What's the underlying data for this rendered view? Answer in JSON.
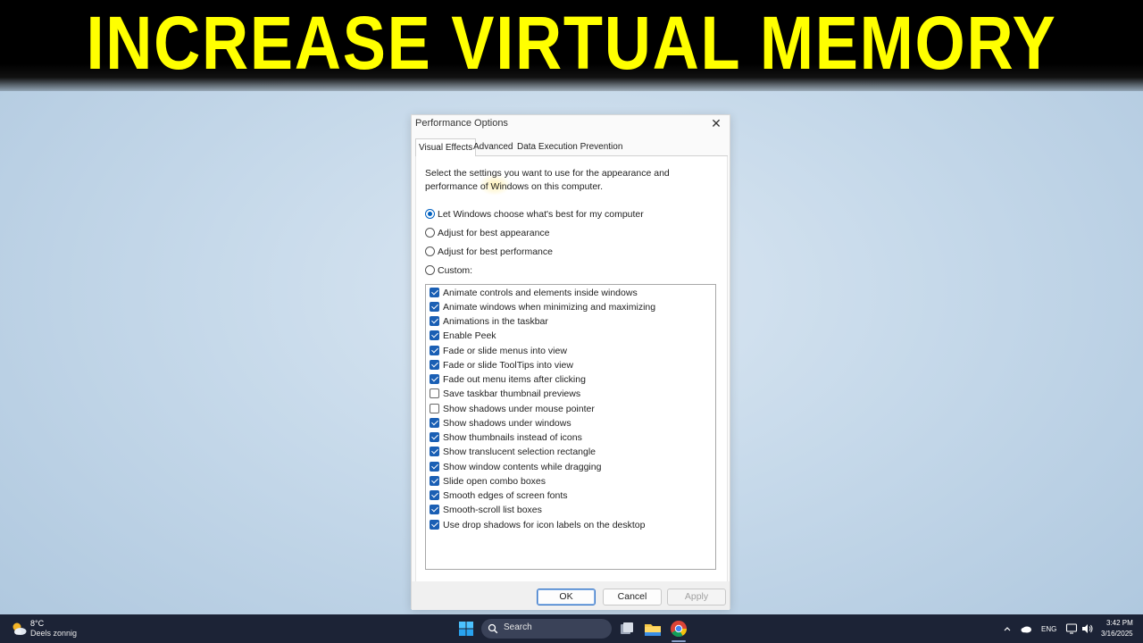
{
  "banner": {
    "title": "INCREASE VIRTUAL MEMORY"
  },
  "dialog": {
    "title": "Performance Options",
    "close": "✕",
    "tabs": [
      "Visual Effects",
      "Advanced",
      "Data Execution Prevention"
    ],
    "active_tab": "Visual Effects",
    "description": "Select the settings you want to use for the appearance and performance of Windows on this computer.",
    "options": [
      {
        "label": "Let Windows choose what's best for my computer",
        "selected": true
      },
      {
        "label": "Adjust for best appearance",
        "selected": false
      },
      {
        "label": "Adjust for best performance",
        "selected": false
      },
      {
        "label": "Custom:",
        "selected": false
      }
    ],
    "effects": [
      {
        "label": "Animate controls and elements inside windows",
        "checked": true
      },
      {
        "label": "Animate windows when minimizing and maximizing",
        "checked": true
      },
      {
        "label": "Animations in the taskbar",
        "checked": true
      },
      {
        "label": "Enable Peek",
        "checked": true
      },
      {
        "label": "Fade or slide menus into view",
        "checked": true
      },
      {
        "label": "Fade or slide ToolTips into view",
        "checked": true
      },
      {
        "label": "Fade out menu items after clicking",
        "checked": true
      },
      {
        "label": "Save taskbar thumbnail previews",
        "checked": false
      },
      {
        "label": "Show shadows under mouse pointer",
        "checked": false
      },
      {
        "label": "Show shadows under windows",
        "checked": true
      },
      {
        "label": "Show thumbnails instead of icons",
        "checked": true
      },
      {
        "label": "Show translucent selection rectangle",
        "checked": true
      },
      {
        "label": "Show window contents while dragging",
        "checked": true
      },
      {
        "label": "Slide open combo boxes",
        "checked": true
      },
      {
        "label": "Smooth edges of screen fonts",
        "checked": true
      },
      {
        "label": "Smooth-scroll list boxes",
        "checked": true
      },
      {
        "label": "Use drop shadows for icon labels on the desktop",
        "checked": true
      }
    ],
    "buttons": {
      "ok": "OK",
      "cancel": "Cancel",
      "apply": "Apply"
    }
  },
  "taskbar": {
    "weather": {
      "temp": "8°C",
      "desc": "Deels zonnig",
      "icon": "partly-sunny-icon"
    },
    "search_label": "Search",
    "apps": [
      "start-icon",
      "search-icon",
      "task-view-icon",
      "file-explorer-icon",
      "chrome-icon"
    ],
    "tray": {
      "lang": "ENG",
      "time": "3:42 PM",
      "date": "3/16/2025"
    }
  },
  "colors": {
    "banner_text": "#ffff00",
    "banner_bg": "#000000",
    "checkbox_accent": "#1a5fb4",
    "taskbar_bg": "#1c2336"
  }
}
